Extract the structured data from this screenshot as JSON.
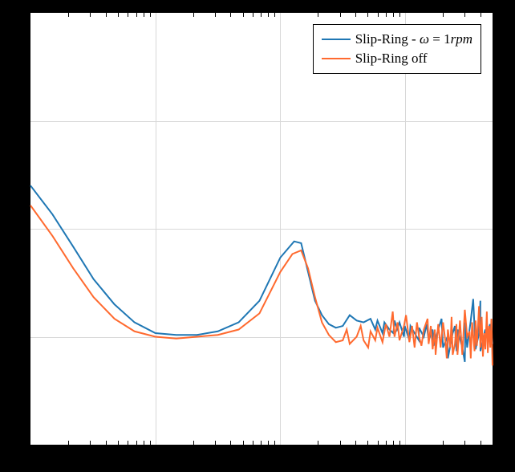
{
  "chart_data": {
    "type": "line",
    "title": "",
    "xlabel": "",
    "ylabel": "",
    "xscale": "log",
    "xlim": [
      0.1,
      500
    ],
    "ylim": [
      -12,
      0
    ],
    "grid": true,
    "legend_position": "upper right",
    "x_major_ticks": [
      0.1,
      1,
      10,
      100
    ],
    "series": [
      {
        "name_tex": "Slip-Ring - \\omega = 1rpm",
        "name_plain": "Slip-Ring - ω = 1rpm",
        "color": "#1f77b4",
        "x": [
          0.1,
          0.15,
          0.22,
          0.32,
          0.47,
          0.68,
          1,
          1.47,
          2.15,
          3.16,
          4.64,
          6.81,
          10,
          12.9,
          14.68,
          16.68,
          18.96,
          21.54,
          24.48,
          27.83,
          31.62,
          35.94,
          40.84,
          46.42,
          52.75,
          57.54,
          59.95,
          65.79,
          68.13,
          74.77,
          80.4,
          82.06,
          86,
          89.97,
          97.72,
          99.06,
          107.98,
          110.07,
          118.85,
          128.67,
          129.15,
          140.91,
          148.6,
          153.99,
          165.81,
          168.18,
          183.77,
          195.32,
          200.82,
          218,
          219.45,
          239.88,
          250,
          257.52,
          262.12,
          286.43,
          300,
          303.59,
          312.97,
          334.62,
          350,
          365.63,
          390,
          399.52,
          400,
          436.55,
          450,
          477.03,
          500
        ],
        "y": [
          -4.8,
          -5.6,
          -6.5,
          -7.4,
          -8.1,
          -8.6,
          -8.9,
          -8.95,
          -8.95,
          -8.85,
          -8.6,
          -8.0,
          -6.8,
          -6.35,
          -6.4,
          -7.2,
          -8.0,
          -8.4,
          -8.65,
          -8.75,
          -8.7,
          -8.4,
          -8.55,
          -8.6,
          -8.5,
          -8.8,
          -8.55,
          -8.9,
          -8.6,
          -8.8,
          -8.9,
          -8.55,
          -8.8,
          -8.6,
          -9.0,
          -8.7,
          -9.1,
          -8.7,
          -8.9,
          -9.1,
          -8.75,
          -9.0,
          -8.65,
          -9.1,
          -8.8,
          -9.25,
          -8.8,
          -8.5,
          -9.3,
          -9.0,
          -9.6,
          -8.9,
          -8.7,
          -9.4,
          -8.8,
          -9.3,
          -9.7,
          -8.6,
          -9.3,
          -8.55,
          -7.95,
          -9.35,
          -8.9,
          -8.0,
          -9.4,
          -8.8,
          -9.0,
          -8.65,
          -9.2
        ]
      },
      {
        "name_plain": "Slip-Ring off",
        "color": "#ff6a2f",
        "x": [
          0.1,
          0.15,
          0.22,
          0.32,
          0.47,
          0.68,
          1,
          1.47,
          2.15,
          3.16,
          4.64,
          6.81,
          10,
          12.5,
          14.68,
          16.68,
          18.96,
          21.54,
          24.48,
          27.83,
          31.62,
          34.0,
          35.94,
          40.84,
          44.0,
          46.42,
          50.5,
          52.75,
          57.54,
          59.95,
          65.79,
          70.0,
          74.77,
          79.43,
          82.06,
          86.85,
          89.97,
          97.72,
          101.5,
          107.98,
          113.5,
          118.85,
          124.1,
          129.15,
          134.9,
          140.91,
          151.0,
          153.99,
          160.32,
          165.81,
          172.63,
          175.0,
          183.77,
          192.0,
          200.82,
          210.14,
          215.0,
          219.45,
          229.6,
          235.0,
          239.88,
          250.0,
          257.0,
          262.12,
          274.27,
          280.0,
          286.43,
          300.0,
          312.97,
          327.47,
          334.62,
          343.25,
          358.86,
          365.63,
          374.67,
          390.0,
          400.04,
          409.34,
          418.77,
          428.4,
          438.28,
          450.0,
          458.36,
          468.93,
          480.0,
          490.0,
          500.0
        ],
        "y": [
          -5.35,
          -6.2,
          -7.1,
          -7.9,
          -8.5,
          -8.85,
          -9.0,
          -9.05,
          -9.0,
          -8.95,
          -8.8,
          -8.35,
          -7.2,
          -6.7,
          -6.6,
          -7.1,
          -7.9,
          -8.6,
          -8.95,
          -9.15,
          -9.1,
          -8.8,
          -9.2,
          -9.0,
          -8.7,
          -9.1,
          -9.3,
          -8.85,
          -9.1,
          -8.75,
          -9.15,
          -8.65,
          -9.0,
          -8.3,
          -9.0,
          -8.6,
          -9.1,
          -8.7,
          -8.4,
          -9.15,
          -8.7,
          -9.3,
          -8.6,
          -9.0,
          -9.25,
          -8.8,
          -8.5,
          -9.2,
          -8.7,
          -9.35,
          -8.8,
          -9.5,
          -8.65,
          -9.3,
          -8.6,
          -9.15,
          -9.6,
          -8.8,
          -9.3,
          -8.45,
          -9.5,
          -9.2,
          -8.65,
          -9.5,
          -8.55,
          -9.0,
          -9.5,
          -8.25,
          -9.0,
          -8.85,
          -9.6,
          -8.6,
          -9.4,
          -8.55,
          -9.25,
          -8.15,
          -9.3,
          -8.45,
          -9.55,
          -8.9,
          -9.35,
          -8.3,
          -9.45,
          -8.7,
          -9.3,
          -8.5,
          -9.8
        ]
      }
    ]
  },
  "legend": {
    "items": [
      {
        "label_html": "Slip-Ring - <span class='ital'>ω</span> = 1<span class='ital'>rpm</span>"
      },
      {
        "label_html": "Slip-Ring off"
      }
    ]
  }
}
